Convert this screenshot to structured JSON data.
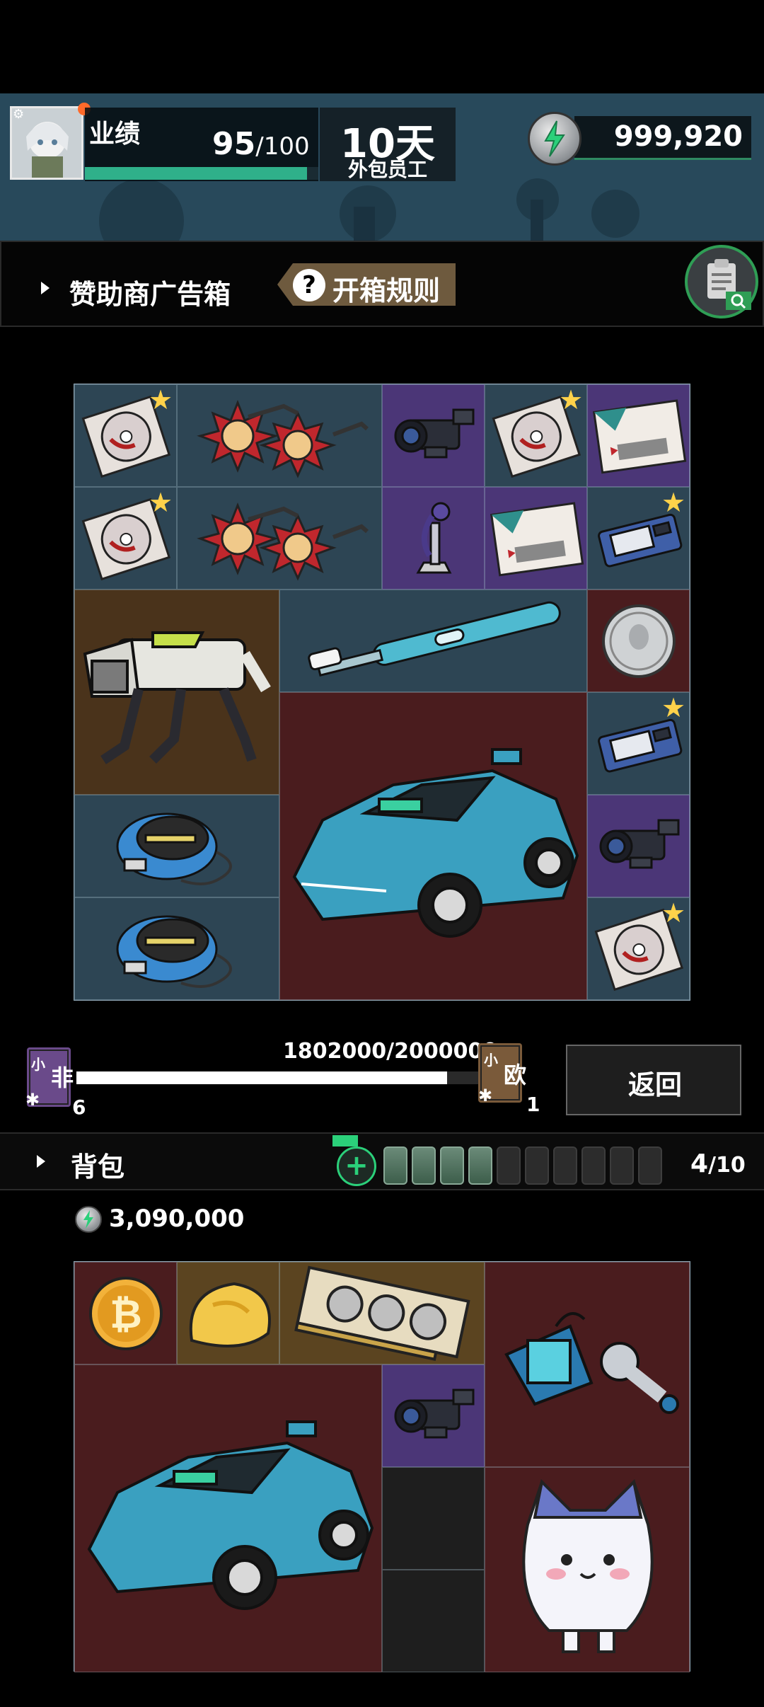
{
  "hud": {
    "performance_label": "业绩",
    "performance_value": "95",
    "performance_max": "/100",
    "performance_progress": 0.95,
    "days_value": "10天",
    "days_subtitle": "外包员工",
    "coins": "999,920"
  },
  "sponsor": {
    "title": "赞助商广告箱",
    "rules_icon": "?",
    "rules_label": "开箱规则"
  },
  "luck": {
    "progress_text": "1802000/2000000",
    "progress_fraction": 0.901,
    "left_badge_text": "非",
    "left_badge_small": "小",
    "left_count": "6",
    "right_badge_text": "欧",
    "right_badge_small": "小",
    "right_count": "1"
  },
  "return_button": "返回",
  "bag": {
    "title": "背包",
    "add_icon": "+",
    "count": "4",
    "capacity": "/10",
    "batteries_full": 4,
    "batteries_total": 10,
    "money": "3,090,000"
  },
  "box_items": [
    "dvd-disc",
    "sun-glasses",
    "camera-scope",
    "dvd-disc",
    "postcard",
    "dvd-disc",
    "sun-glasses",
    "figure-trophy",
    "postcard",
    "memory-card",
    "robot-dog",
    "electric-toothbrush",
    "silver-coin",
    "memory-card",
    "sports-car",
    "portable-cd-player",
    "camera-scope",
    "portable-cd-player",
    "dvd-disc"
  ],
  "bag_items": [
    "bitcoin-coin",
    "bread-bun",
    "graphics-card",
    "robot-arm",
    "camera-scope",
    "sports-car",
    "cat-mascot"
  ],
  "colors": {
    "cell_blue": "#2d4554",
    "cell_purple": "#4b3677",
    "cell_brown": "#4a331b",
    "cell_red": "#4a1c1e",
    "accent_green": "#2bd07a",
    "star_gold": "#ffd24a"
  }
}
